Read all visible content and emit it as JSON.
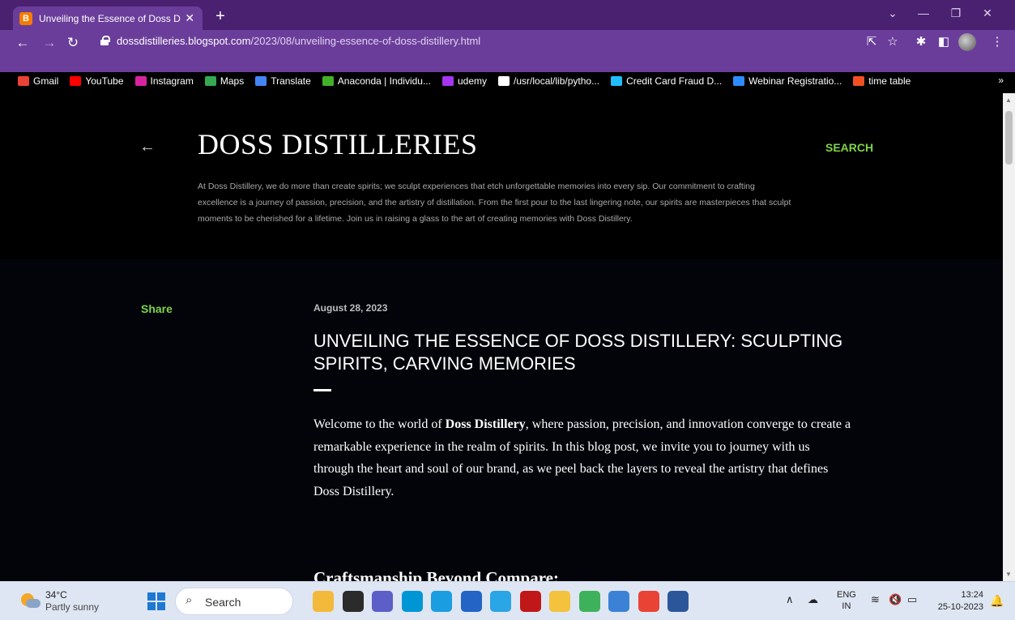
{
  "browser": {
    "tab_title": "Unveiling the Essence of Doss D",
    "tab_favicon": "B",
    "tab_close": "✕",
    "new_tab": "+",
    "url_host": "dossdistilleries.blogspot.com",
    "url_path": "/2023/08/unveiling-essence-of-doss-distillery.html",
    "bookmarks": [
      {
        "label": "Gmail",
        "color": "#ea4335"
      },
      {
        "label": "YouTube",
        "color": "#ff0000"
      },
      {
        "label": "Instagram",
        "color": "#d6249f"
      },
      {
        "label": "Maps",
        "color": "#34a853"
      },
      {
        "label": "Translate",
        "color": "#4285f4"
      },
      {
        "label": "Anaconda | Individu...",
        "color": "#43b02a"
      },
      {
        "label": "udemy",
        "color": "#a435f0"
      },
      {
        "label": "/usr/local/lib/pytho...",
        "color": "#ffffff"
      },
      {
        "label": "Credit Card Fraud D...",
        "color": "#20beff"
      },
      {
        "label": "Webinar Registratio...",
        "color": "#2d8cff"
      },
      {
        "label": "time table",
        "color": "#f25022"
      }
    ],
    "bookmarks_more": "»"
  },
  "blog": {
    "title": "DOSS DISTILLERIES",
    "search_label": "SEARCH",
    "description": "At Doss Distillery, we do more than create spirits; we sculpt experiences that etch unforgettable memories into every sip. Our commitment to crafting excellence is a journey of passion, precision, and the artistry of distillation. From the first pour to the last lingering note, our spirits are masterpieces that sculpt moments to be cherished for a lifetime. Join us in raising a glass to the art of creating memories with Doss Distillery."
  },
  "post": {
    "share_label": "Share",
    "date": "August 28, 2023",
    "title": "UNVEILING THE ESSENCE OF DOSS DISTILLERY: SCULPTING SPIRITS, CARVING MEMORIES",
    "body_intro": "Welcome to the world of ",
    "body_brand": "Doss Distillery",
    "body_rest": ", where passion, precision, and innovation converge to create a remarkable experience in the realm of spirits. In this blog post, we invite you to journey with us through the heart and soul of our brand, as we peel back the layers to reveal the artistry that defines Doss Distillery.",
    "section_heading": "Craftsmanship Beyond Compare:"
  },
  "taskbar": {
    "temperature": "34°C",
    "condition": "Partly sunny",
    "search_label": "Search",
    "lang_top": "ENG",
    "lang_bottom": "IN",
    "time": "13:24",
    "date": "25-10-2023",
    "apps": [
      {
        "name": "widgets-app-icon",
        "color": "#f3b93a"
      },
      {
        "name": "file-explorer-icon",
        "color": "#2b2b2b"
      },
      {
        "name": "chat-app-icon",
        "color": "#5b5fc7"
      },
      {
        "name": "myhp-app-icon",
        "color": "#0096d6"
      },
      {
        "name": "edge-browser-icon",
        "color": "#1b9de2"
      },
      {
        "name": "store-app-icon",
        "color": "#2364c4"
      },
      {
        "name": "chrome-canary-icon",
        "color": "#2aa5e6"
      },
      {
        "name": "mcafee-app-icon",
        "color": "#c01818"
      },
      {
        "name": "folder-app-icon",
        "color": "#f4c23c"
      },
      {
        "name": "chrome-dev-icon",
        "color": "#3db25a"
      },
      {
        "name": "notepad-app-icon",
        "color": "#3b82d6"
      },
      {
        "name": "chrome-browser-icon",
        "color": "#e94335"
      },
      {
        "name": "word-app-icon",
        "color": "#2b579a"
      }
    ]
  }
}
